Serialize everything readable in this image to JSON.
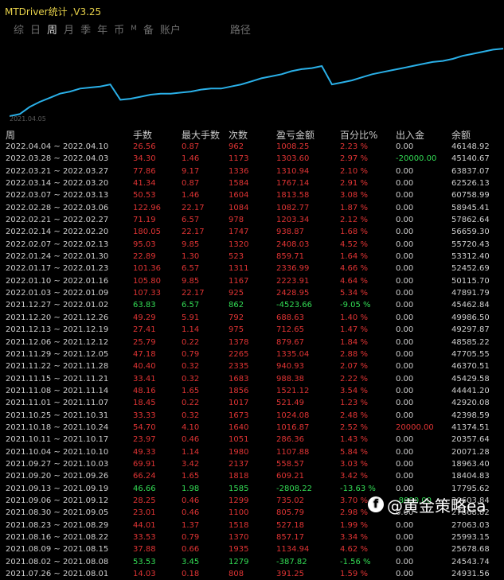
{
  "window": {
    "title": "MTDriver统计 ,V3.25"
  },
  "tabs": [
    {
      "label": "综",
      "active": false,
      "small": false
    },
    {
      "label": "日",
      "active": false,
      "small": false
    },
    {
      "label": "周",
      "active": true,
      "small": false
    },
    {
      "label": "月",
      "active": false,
      "small": false
    },
    {
      "label": "季",
      "active": false,
      "small": false
    },
    {
      "label": "年",
      "active": false,
      "small": false
    },
    {
      "label": "币",
      "active": false,
      "small": false
    },
    {
      "label": "M",
      "active": false,
      "small": true
    },
    {
      "label": "备",
      "active": false,
      "small": false
    },
    {
      "label": "账户",
      "active": false,
      "small": false
    }
  ],
  "path_tab": "路径",
  "chart_data": {
    "type": "line",
    "x_label_start": "2021.04.05",
    "line_color": "#2ab0e8",
    "y": [
      0.0,
      0.02,
      0.09,
      0.14,
      0.18,
      0.22,
      0.24,
      0.27,
      0.28,
      0.29,
      0.31,
      0.16,
      0.17,
      0.19,
      0.21,
      0.22,
      0.22,
      0.23,
      0.24,
      0.26,
      0.27,
      0.27,
      0.29,
      0.31,
      0.34,
      0.37,
      0.39,
      0.41,
      0.44,
      0.46,
      0.47,
      0.49,
      0.31,
      0.33,
      0.35,
      0.38,
      0.41,
      0.43,
      0.45,
      0.47,
      0.49,
      0.51,
      0.53,
      0.54,
      0.56,
      0.59,
      0.61,
      0.63,
      0.65,
      0.66
    ]
  },
  "headers": [
    "周",
    "手数",
    "最大手数",
    "次数",
    "盈亏金额",
    "百分比%",
    "出入金",
    "余额"
  ],
  "rows": [
    {
      "week": "2022.04.04 ~ 2022.04.10",
      "lots": "26.56",
      "max_lots": "0.87",
      "count": "962",
      "pnl": "1008.25",
      "pct": "2.23 %",
      "inout": "0.00",
      "balance": "46148.92",
      "sign": "neg",
      "inout_color": ""
    },
    {
      "week": "2022.03.28 ~ 2022.04.03",
      "lots": "34.30",
      "max_lots": "1.46",
      "count": "1173",
      "pnl": "1303.60",
      "pct": "2.97 %",
      "inout": "-20000.00",
      "balance": "45140.67",
      "sign": "neg",
      "inout_color": "green"
    },
    {
      "week": "2022.03.21 ~ 2022.03.27",
      "lots": "77.86",
      "max_lots": "9.17",
      "count": "1336",
      "pnl": "1310.94",
      "pct": "2.10 %",
      "inout": "0.00",
      "balance": "63837.07",
      "sign": "neg",
      "inout_color": ""
    },
    {
      "week": "2022.03.14 ~ 2022.03.20",
      "lots": "41.34",
      "max_lots": "0.87",
      "count": "1584",
      "pnl": "1767.14",
      "pct": "2.91 %",
      "inout": "0.00",
      "balance": "62526.13",
      "sign": "neg",
      "inout_color": ""
    },
    {
      "week": "2022.03.07 ~ 2022.03.13",
      "lots": "50.53",
      "max_lots": "1.46",
      "count": "1604",
      "pnl": "1813.58",
      "pct": "3.08 %",
      "inout": "0.00",
      "balance": "60758.99",
      "sign": "neg",
      "inout_color": ""
    },
    {
      "week": "2022.02.28 ~ 2022.03.06",
      "lots": "122.96",
      "max_lots": "22.17",
      "count": "1084",
      "pnl": "1082.77",
      "pct": "1.87 %",
      "inout": "0.00",
      "balance": "58945.41",
      "sign": "neg",
      "inout_color": ""
    },
    {
      "week": "2022.02.21 ~ 2022.02.27",
      "lots": "71.19",
      "max_lots": "6.57",
      "count": "978",
      "pnl": "1203.34",
      "pct": "2.12 %",
      "inout": "0.00",
      "balance": "57862.64",
      "sign": "neg",
      "inout_color": ""
    },
    {
      "week": "2022.02.14 ~ 2022.02.20",
      "lots": "180.05",
      "max_lots": "22.17",
      "count": "1747",
      "pnl": "938.87",
      "pct": "1.68 %",
      "inout": "0.00",
      "balance": "56659.30",
      "sign": "neg",
      "inout_color": ""
    },
    {
      "week": "2022.02.07 ~ 2022.02.13",
      "lots": "95.03",
      "max_lots": "9.85",
      "count": "1320",
      "pnl": "2408.03",
      "pct": "4.52 %",
      "inout": "0.00",
      "balance": "55720.43",
      "sign": "neg",
      "inout_color": ""
    },
    {
      "week": "2022.01.24 ~ 2022.01.30",
      "lots": "22.89",
      "max_lots": "1.30",
      "count": "523",
      "pnl": "859.71",
      "pct": "1.64 %",
      "inout": "0.00",
      "balance": "53312.40",
      "sign": "neg",
      "inout_color": ""
    },
    {
      "week": "2022.01.17 ~ 2022.01.23",
      "lots": "101.36",
      "max_lots": "6.57",
      "count": "1311",
      "pnl": "2336.99",
      "pct": "4.66 %",
      "inout": "0.00",
      "balance": "52452.69",
      "sign": "neg",
      "inout_color": ""
    },
    {
      "week": "2022.01.10 ~ 2022.01.16",
      "lots": "105.80",
      "max_lots": "9.85",
      "count": "1167",
      "pnl": "2223.91",
      "pct": "4.64 %",
      "inout": "0.00",
      "balance": "50115.70",
      "sign": "neg",
      "inout_color": ""
    },
    {
      "week": "2022.01.03 ~ 2022.01.09",
      "lots": "107.33",
      "max_lots": "22.17",
      "count": "925",
      "pnl": "2428.95",
      "pct": "5.34 %",
      "inout": "0.00",
      "balance": "47891.79",
      "sign": "neg",
      "inout_color": ""
    },
    {
      "week": "2021.12.27 ~ 2022.01.02",
      "lots": "63.83",
      "max_lots": "6.57",
      "count": "862",
      "pnl": "-4523.66",
      "pct": "-9.05 %",
      "inout": "0.00",
      "balance": "45462.84",
      "sign": "pos",
      "inout_color": ""
    },
    {
      "week": "2021.12.20 ~ 2021.12.26",
      "lots": "49.29",
      "max_lots": "5.91",
      "count": "792",
      "pnl": "688.63",
      "pct": "1.40 %",
      "inout": "0.00",
      "balance": "49986.50",
      "sign": "neg",
      "inout_color": ""
    },
    {
      "week": "2021.12.13 ~ 2021.12.19",
      "lots": "27.41",
      "max_lots": "1.14",
      "count": "975",
      "pnl": "712.65",
      "pct": "1.47 %",
      "inout": "0.00",
      "balance": "49297.87",
      "sign": "neg",
      "inout_color": ""
    },
    {
      "week": "2021.12.06 ~ 2021.12.12",
      "lots": "25.79",
      "max_lots": "0.22",
      "count": "1378",
      "pnl": "879.67",
      "pct": "1.84 %",
      "inout": "0.00",
      "balance": "48585.22",
      "sign": "neg",
      "inout_color": ""
    },
    {
      "week": "2021.11.29 ~ 2021.12.05",
      "lots": "47.18",
      "max_lots": "0.79",
      "count": "2265",
      "pnl": "1335.04",
      "pct": "2.88 %",
      "inout": "0.00",
      "balance": "47705.55",
      "sign": "neg",
      "inout_color": ""
    },
    {
      "week": "2021.11.22 ~ 2021.11.28",
      "lots": "40.40",
      "max_lots": "0.32",
      "count": "2335",
      "pnl": "940.93",
      "pct": "2.07 %",
      "inout": "0.00",
      "balance": "46370.51",
      "sign": "neg",
      "inout_color": ""
    },
    {
      "week": "2021.11.15 ~ 2021.11.21",
      "lots": "33.41",
      "max_lots": "0.32",
      "count": "1683",
      "pnl": "988.38",
      "pct": "2.22 %",
      "inout": "0.00",
      "balance": "45429.58",
      "sign": "neg",
      "inout_color": ""
    },
    {
      "week": "2021.11.08 ~ 2021.11.14",
      "lots": "48.16",
      "max_lots": "1.65",
      "count": "1856",
      "pnl": "1521.12",
      "pct": "3.54 %",
      "inout": "0.00",
      "balance": "44441.20",
      "sign": "neg",
      "inout_color": ""
    },
    {
      "week": "2021.11.01 ~ 2021.11.07",
      "lots": "18.45",
      "max_lots": "0.22",
      "count": "1017",
      "pnl": "521.49",
      "pct": "1.23 %",
      "inout": "0.00",
      "balance": "42920.08",
      "sign": "neg",
      "inout_color": ""
    },
    {
      "week": "2021.10.25 ~ 2021.10.31",
      "lots": "33.33",
      "max_lots": "0.32",
      "count": "1673",
      "pnl": "1024.08",
      "pct": "2.48 %",
      "inout": "0.00",
      "balance": "42398.59",
      "sign": "neg",
      "inout_color": ""
    },
    {
      "week": "2021.10.18 ~ 2021.10.24",
      "lots": "54.70",
      "max_lots": "4.10",
      "count": "1640",
      "pnl": "1016.87",
      "pct": "2.52 %",
      "inout": "20000.00",
      "balance": "41374.51",
      "sign": "neg",
      "inout_color": "red"
    },
    {
      "week": "2021.10.11 ~ 2021.10.17",
      "lots": "23.97",
      "max_lots": "0.46",
      "count": "1051",
      "pnl": "286.36",
      "pct": "1.43 %",
      "inout": "0.00",
      "balance": "20357.64",
      "sign": "neg",
      "inout_color": ""
    },
    {
      "week": "2021.10.04 ~ 2021.10.10",
      "lots": "49.33",
      "max_lots": "1.14",
      "count": "1980",
      "pnl": "1107.88",
      "pct": "5.84 %",
      "inout": "0.00",
      "balance": "20071.28",
      "sign": "neg",
      "inout_color": ""
    },
    {
      "week": "2021.09.27 ~ 2021.10.03",
      "lots": "69.91",
      "max_lots": "3.42",
      "count": "2137",
      "pnl": "558.57",
      "pct": "3.03 %",
      "inout": "0.00",
      "balance": "18963.40",
      "sign": "neg",
      "inout_color": ""
    },
    {
      "week": "2021.09.20 ~ 2021.09.26",
      "lots": "66.24",
      "max_lots": "1.65",
      "count": "1818",
      "pnl": "609.21",
      "pct": "3.42 %",
      "inout": "0.00",
      "balance": "18404.83",
      "sign": "neg",
      "inout_color": ""
    },
    {
      "week": "2021.09.13 ~ 2021.09.19",
      "lots": "46.66",
      "max_lots": "1.98",
      "count": "1585",
      "pnl": "-2808.22",
      "pct": "-13.63 %",
      "inout": "0.00",
      "balance": "17795.62",
      "sign": "pos",
      "inout_color": ""
    },
    {
      "week": "2021.09.06 ~ 2021.09.12",
      "lots": "28.25",
      "max_lots": "0.46",
      "count": "1299",
      "pnl": "735.02",
      "pct": "3.70 %",
      "inout": "-8000.00",
      "balance": "20603.84",
      "sign": "neg",
      "inout_color": "green"
    },
    {
      "week": "2021.08.30 ~ 2021.09.05",
      "lots": "23.01",
      "max_lots": "0.46",
      "count": "1100",
      "pnl": "805.79",
      "pct": "2.98 %",
      "inout": "0.00",
      "balance": "27868.82",
      "sign": "neg",
      "inout_color": ""
    },
    {
      "week": "2021.08.23 ~ 2021.08.29",
      "lots": "44.01",
      "max_lots": "1.37",
      "count": "1518",
      "pnl": "527.18",
      "pct": "1.99 %",
      "inout": "0.00",
      "balance": "27063.03",
      "sign": "neg",
      "inout_color": ""
    },
    {
      "week": "2021.08.16 ~ 2021.08.22",
      "lots": "33.53",
      "max_lots": "0.79",
      "count": "1370",
      "pnl": "857.17",
      "pct": "3.34 %",
      "inout": "0.00",
      "balance": "25993.15",
      "sign": "neg",
      "inout_color": ""
    },
    {
      "week": "2021.08.09 ~ 2021.08.15",
      "lots": "37.88",
      "max_lots": "0.66",
      "count": "1935",
      "pnl": "1134.94",
      "pct": "4.62 %",
      "inout": "0.00",
      "balance": "25678.68",
      "sign": "neg",
      "inout_color": ""
    },
    {
      "week": "2021.08.02 ~ 2021.08.08",
      "lots": "53.53",
      "max_lots": "3.45",
      "count": "1279",
      "pnl": "-387.82",
      "pct": "-1.56 %",
      "inout": "0.00",
      "balance": "24543.74",
      "sign": "pos",
      "inout_color": ""
    },
    {
      "week": "2021.07.26 ~ 2021.08.01",
      "lots": "14.03",
      "max_lots": "0.18",
      "count": "808",
      "pnl": "391.25",
      "pct": "1.59 %",
      "inout": "0.00",
      "balance": "24931.56",
      "sign": "neg",
      "inout_color": ""
    }
  ],
  "watermark": {
    "icon": "f",
    "text": "@黄金策略ea"
  }
}
